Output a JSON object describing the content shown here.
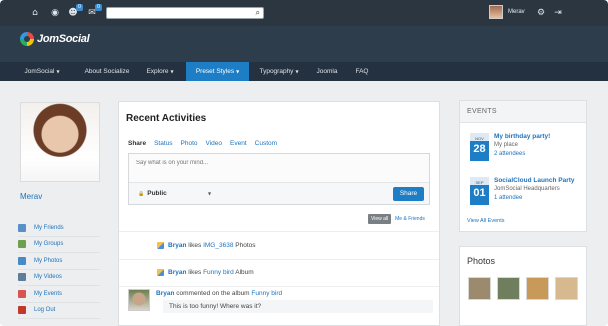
{
  "toolbar": {
    "notif_badge": "0",
    "msg_badge": "0",
    "search": {
      "placeholder": "",
      "value": ""
    },
    "user_name": "Merav"
  },
  "brand": {
    "name": "JomSocial"
  },
  "nav": {
    "items": [
      {
        "label": "JomSocial",
        "caret": true
      },
      {
        "label": "About Socialize",
        "caret": false
      },
      {
        "label": "Explore",
        "caret": true
      },
      {
        "label": "Preset Styles",
        "caret": true,
        "active": true
      },
      {
        "label": "Typography",
        "caret": true
      },
      {
        "label": "Joomla",
        "caret": false
      },
      {
        "label": "FAQ",
        "caret": false
      }
    ]
  },
  "profile": {
    "name": "Merav",
    "menu": [
      {
        "label": "My Friends",
        "icon": "friends-icon",
        "color": "#5b8fc9"
      },
      {
        "label": "My Groups",
        "icon": "groups-icon",
        "color": "#6d9f4e"
      },
      {
        "label": "My Photos",
        "icon": "photos-icon",
        "color": "#4a89c7"
      },
      {
        "label": "My Videos",
        "icon": "videos-icon",
        "color": "#5f7d9a"
      },
      {
        "label": "My Events",
        "icon": "events-icon",
        "color": "#d9534f"
      },
      {
        "label": "Log Out",
        "icon": "logout-icon",
        "color": "#c0392b"
      }
    ]
  },
  "activity": {
    "title": "Recent Activities",
    "share_tabs": [
      "Share",
      "Status",
      "Photo",
      "Video",
      "Event",
      "Custom"
    ],
    "composer_placeholder": "Say what is on your mind...",
    "privacy": "Public",
    "share_button": "Share",
    "filter_view_all": "View all",
    "filter_me_friends": "Me & Friends",
    "items": [
      {
        "actor": "Bryan",
        "verb": "likes",
        "object": "IMG_3638",
        "suffix": "Photos"
      },
      {
        "actor": "Bryan",
        "verb": "likes",
        "object": "Funny bird",
        "suffix": "Album"
      }
    ],
    "comment": {
      "actor": "Bryan",
      "text": "commented on the album",
      "object": "Funny bird",
      "body": "This is too funny! Where was it?"
    }
  },
  "events": {
    "header": "EVENTS",
    "list": [
      {
        "month": "NOV",
        "day": "28",
        "title": "My birthday party!",
        "location": "My place",
        "attendees": "2 attendees"
      },
      {
        "month": "SEP",
        "day": "01",
        "title": "SocialCloud Launch Party",
        "location": "JomSocial Headquarters",
        "attendees": "1 attendee"
      }
    ],
    "view_all": "View All Events"
  },
  "photos": {
    "title": "Photos",
    "thumb_colors": [
      "#9b8a6e",
      "#6f7f5d",
      "#c89a5a",
      "#d7b98f",
      "#aeb7bd"
    ]
  }
}
